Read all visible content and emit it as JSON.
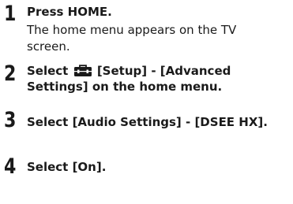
{
  "steps": [
    {
      "number": "1",
      "title": "Press HOME.",
      "description": "The home menu appears on the TV screen."
    },
    {
      "number": "2",
      "title_before_icon": "Select",
      "icon": "toolbox-icon",
      "title_after_icon": "[Setup] - [Advanced Settings] on the home menu."
    },
    {
      "number": "3",
      "title": "Select [Audio Settings] - [DSEE HX]."
    },
    {
      "number": "4",
      "title": "Select [On]."
    }
  ]
}
